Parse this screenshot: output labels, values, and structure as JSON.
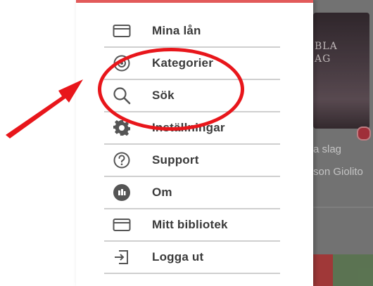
{
  "menu": {
    "items": [
      {
        "label": "Mina lån",
        "icon": "card-icon"
      },
      {
        "label": "Kategorier",
        "icon": "target-icon"
      },
      {
        "label": "Sök",
        "icon": "search-icon"
      },
      {
        "label": "Inställningar",
        "icon": "gear-icon"
      },
      {
        "label": "Support",
        "icon": "help-icon"
      },
      {
        "label": "Om",
        "icon": "info-icon"
      },
      {
        "label": "Mitt bibliotek",
        "icon": "card-icon"
      },
      {
        "label": "Logga ut",
        "icon": "logout-icon"
      }
    ]
  },
  "background": {
    "cover_line1": "BLA",
    "cover_line2": "AG",
    "book_title": "a slag",
    "book_author": "son Giolito"
  },
  "annotations": {
    "highlight_color": "#e8161b",
    "arrow_color": "#e8161b"
  },
  "colors": {
    "drawer_accent": "#e25a5a"
  }
}
